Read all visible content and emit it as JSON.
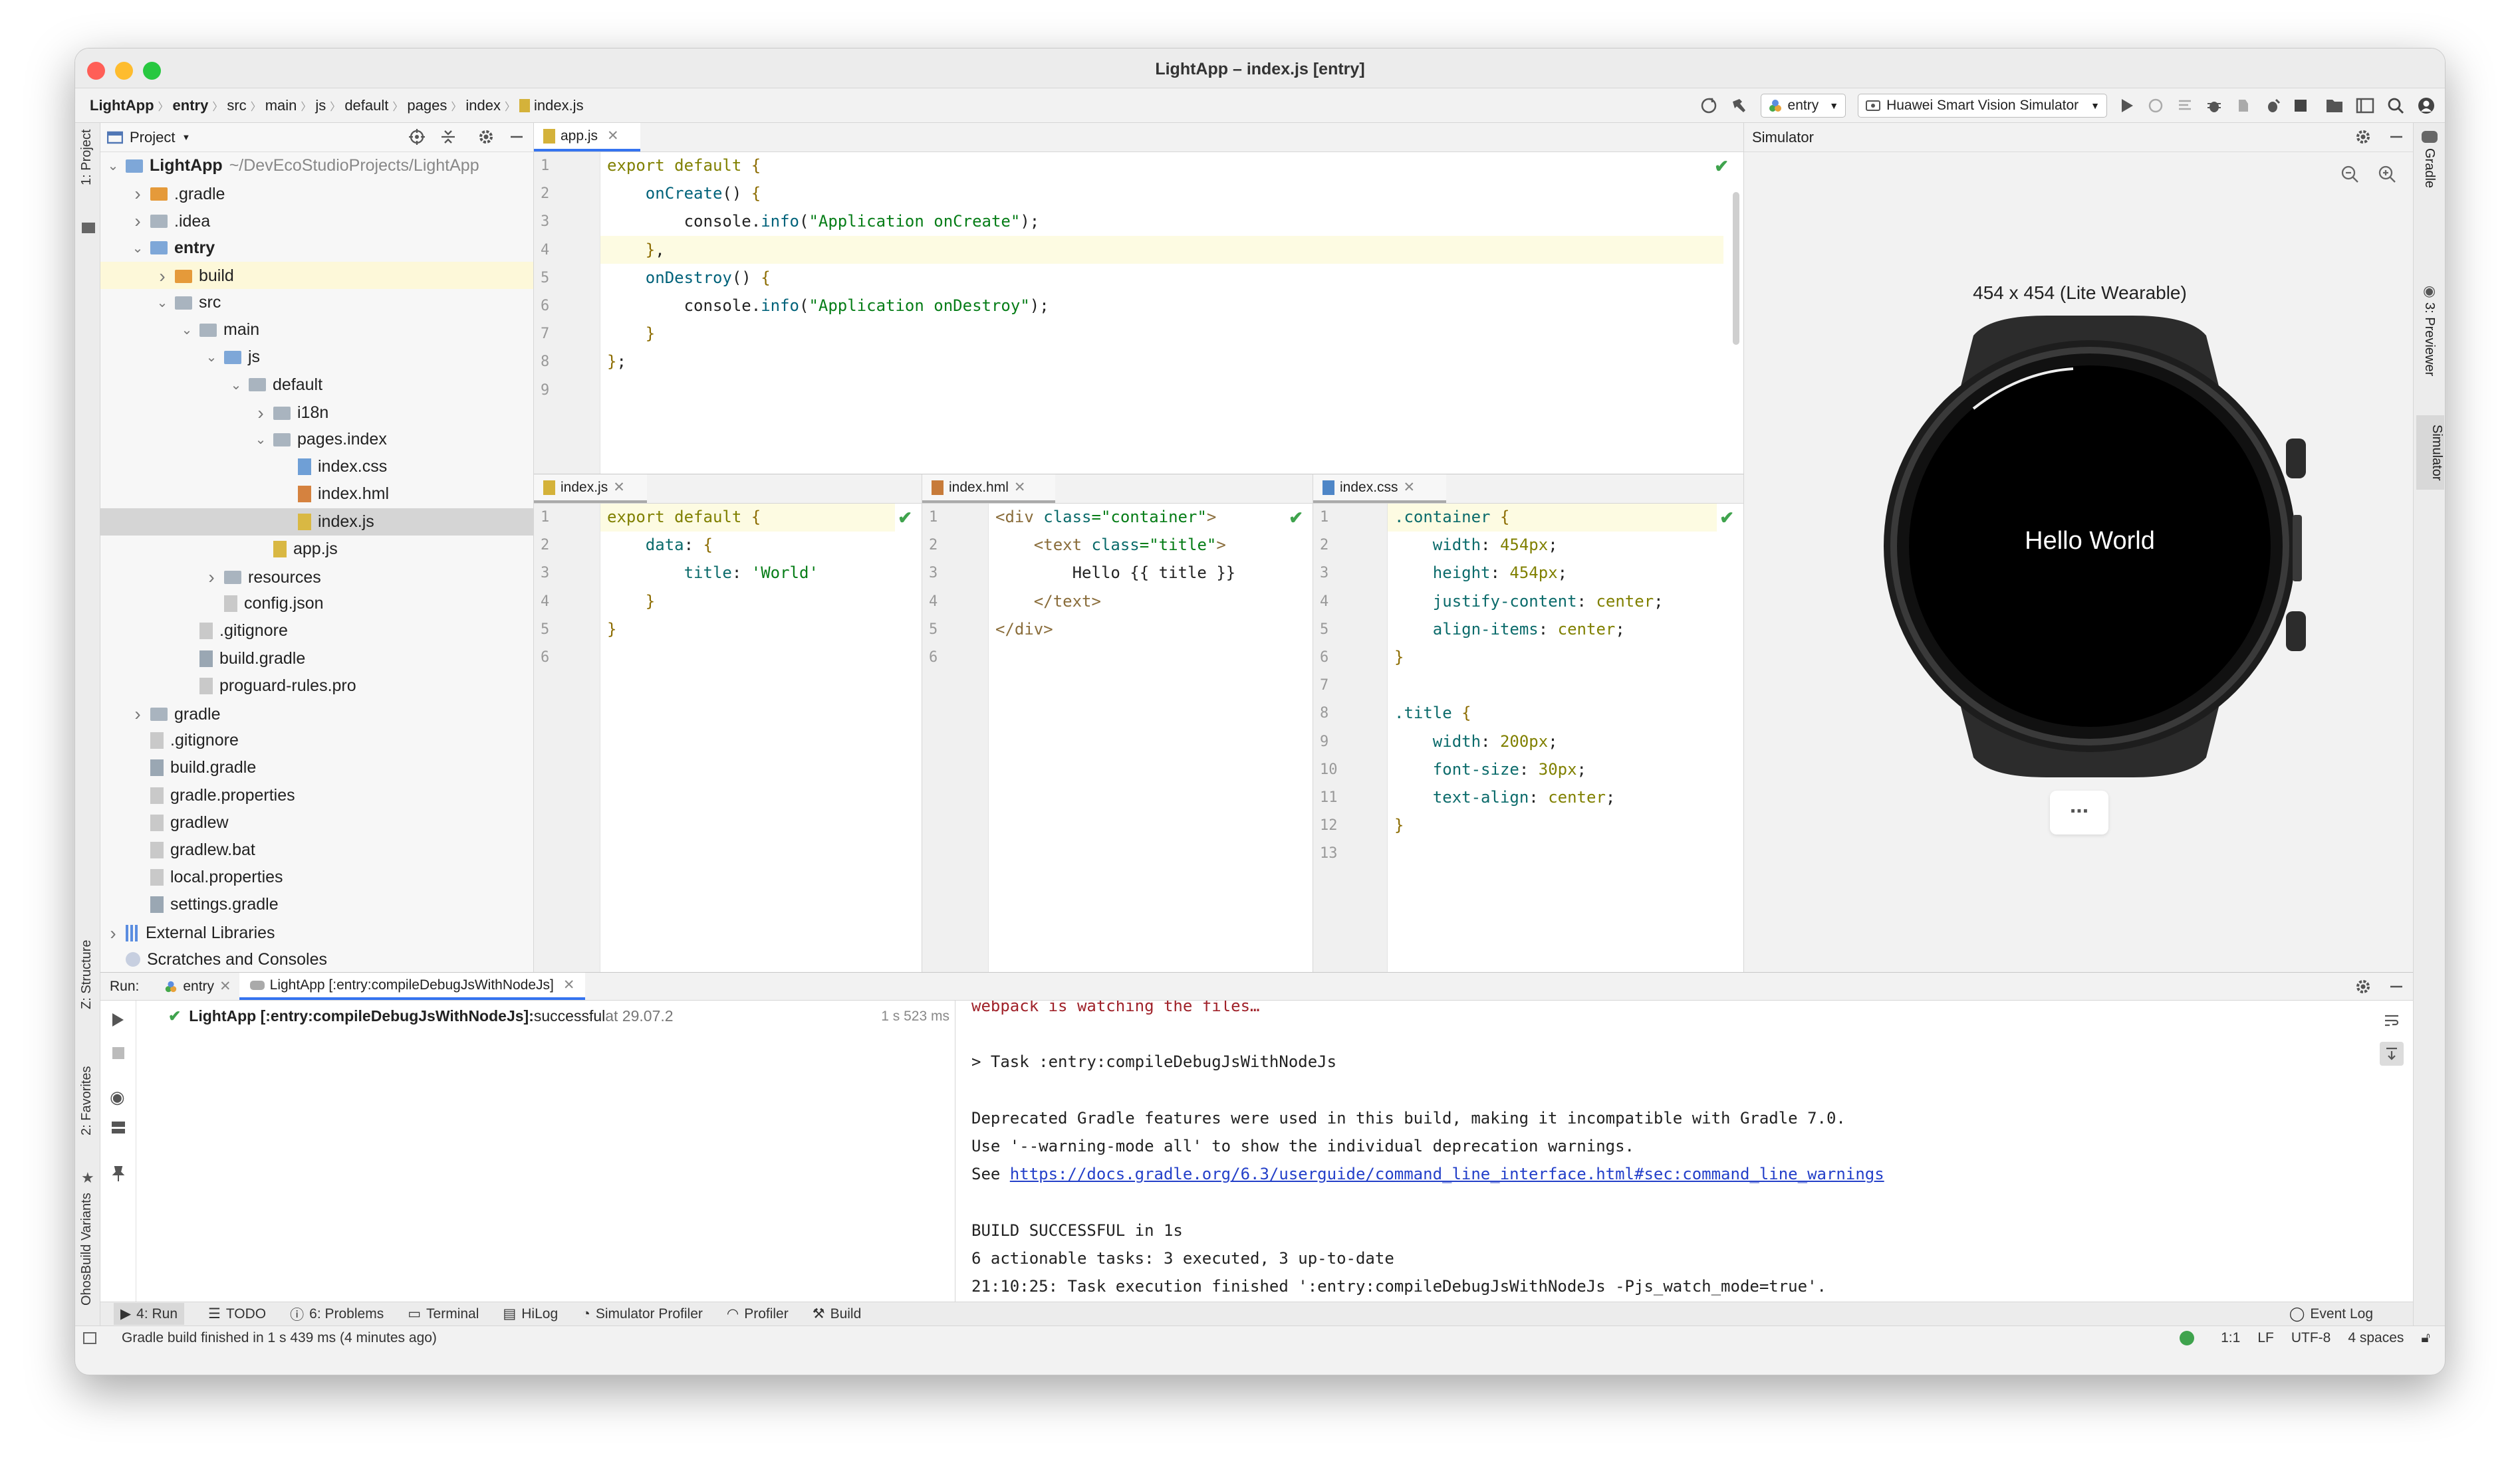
{
  "window": {
    "title": "LightApp – index.js [entry]"
  },
  "breadcrumbs": [
    "LightApp",
    "entry",
    "src",
    "main",
    "js",
    "default",
    "pages",
    "index",
    "index.js"
  ],
  "toolbar": {
    "run_config": "entry",
    "device": "Huawei Smart Vision Simulator"
  },
  "project_panel": {
    "title": "Project"
  },
  "tree": [
    {
      "label": "LightApp",
      "suffix": " ~/DevEcoStudioProjects/LightApp",
      "depth": 0,
      "arrow": "down",
      "icon": "module",
      "bold": true
    },
    {
      "label": ".gradle",
      "depth": 1,
      "arrow": "right",
      "icon": "folder-orange"
    },
    {
      "label": ".idea",
      "depth": 1,
      "arrow": "right",
      "icon": "folder"
    },
    {
      "label": "entry",
      "depth": 1,
      "arrow": "down",
      "icon": "module",
      "bold": true
    },
    {
      "label": "build",
      "depth": 2,
      "arrow": "right",
      "icon": "folder-orange",
      "hl": "yellow"
    },
    {
      "label": "src",
      "depth": 2,
      "arrow": "down",
      "icon": "folder"
    },
    {
      "label": "main",
      "depth": 3,
      "arrow": "down",
      "icon": "folder"
    },
    {
      "label": "js",
      "depth": 4,
      "arrow": "down",
      "icon": "folder-blue"
    },
    {
      "label": "default",
      "depth": 5,
      "arrow": "down",
      "icon": "folder"
    },
    {
      "label": "i18n",
      "depth": 6,
      "arrow": "right",
      "icon": "folder"
    },
    {
      "label": "pages.index",
      "depth": 6,
      "arrow": "down",
      "icon": "folder"
    },
    {
      "label": "index.css",
      "depth": 7,
      "arrow": "",
      "icon": "css"
    },
    {
      "label": "index.hml",
      "depth": 7,
      "arrow": "",
      "icon": "hml"
    },
    {
      "label": "index.js",
      "depth": 7,
      "arrow": "",
      "icon": "js",
      "hl": "selected"
    },
    {
      "label": "app.js",
      "depth": 6,
      "arrow": "",
      "icon": "js"
    },
    {
      "label": "resources",
      "depth": 4,
      "arrow": "right",
      "icon": "folder"
    },
    {
      "label": "config.json",
      "depth": 4,
      "arrow": "",
      "icon": "json"
    },
    {
      "label": ".gitignore",
      "depth": 3,
      "arrow": "",
      "icon": "file"
    },
    {
      "label": "build.gradle",
      "depth": 3,
      "arrow": "",
      "icon": "gradle"
    },
    {
      "label": "proguard-rules.pro",
      "depth": 3,
      "arrow": "",
      "icon": "file"
    },
    {
      "label": "gradle",
      "depth": 1,
      "arrow": "right",
      "icon": "folder"
    },
    {
      "label": ".gitignore",
      "depth": 1,
      "arrow": "",
      "icon": "file"
    },
    {
      "label": "build.gradle",
      "depth": 1,
      "arrow": "",
      "icon": "gradle"
    },
    {
      "label": "gradle.properties",
      "depth": 1,
      "arrow": "",
      "icon": "file"
    },
    {
      "label": "gradlew",
      "depth": 1,
      "arrow": "",
      "icon": "file"
    },
    {
      "label": "gradlew.bat",
      "depth": 1,
      "arrow": "",
      "icon": "file"
    },
    {
      "label": "local.properties",
      "depth": 1,
      "arrow": "",
      "icon": "file"
    },
    {
      "label": "settings.gradle",
      "depth": 1,
      "arrow": "",
      "icon": "gradle"
    },
    {
      "label": "External Libraries",
      "depth": 0,
      "arrow": "right",
      "icon": "lib"
    },
    {
      "label": "Scratches and Consoles",
      "depth": 0,
      "arrow": "",
      "icon": "scratch"
    }
  ],
  "left_strip": {
    "project": "1: Project",
    "structure": "Z: Structure",
    "favorites": "2: Favorites",
    "build_variants": "OhosBuild Variants"
  },
  "right_strip": {
    "gradle": "Gradle",
    "previewer": "3: Previewer",
    "simulator": "Simulator"
  },
  "editors": {
    "top": {
      "tab": "app.js",
      "lines": [
        [
          [
            "kwo",
            "export default "
          ],
          [
            "k1",
            "{"
          ]
        ],
        [
          [
            "fn",
            "    onCreate"
          ],
          [
            "",
            "() "
          ],
          [
            "k1",
            "{"
          ]
        ],
        [
          [
            "",
            "        console."
          ],
          [
            "fn",
            "info"
          ],
          [
            "",
            "("
          ],
          [
            "st",
            "\"Application onCreate\""
          ],
          [
            "",
            ");"
          ]
        ],
        [
          [
            "k1",
            "    }"
          ],
          [
            "",
            ","
          ]
        ],
        [
          [
            "fn",
            "    onDestroy"
          ],
          [
            "",
            "() "
          ],
          [
            "k1",
            "{"
          ]
        ],
        [
          [
            "",
            "        console."
          ],
          [
            "fn",
            "info"
          ],
          [
            "",
            "("
          ],
          [
            "st",
            "\"Application onDestroy\""
          ],
          [
            "",
            ");"
          ]
        ],
        [
          [
            "k1",
            "    }"
          ]
        ],
        [
          [
            "k1",
            "}"
          ],
          [
            "",
            ";"
          ]
        ],
        []
      ]
    },
    "js": {
      "tab": "index.js",
      "lines": [
        [
          [
            "kwo",
            "export default "
          ],
          [
            "k1",
            "{"
          ]
        ],
        [
          [
            "prop",
            "    data"
          ],
          [
            "",
            ": "
          ],
          [
            "k1",
            "{"
          ]
        ],
        [
          [
            "prop",
            "        title"
          ],
          [
            "",
            ": "
          ],
          [
            "st",
            "'World'"
          ]
        ],
        [
          [
            "k1",
            "    }"
          ]
        ],
        [
          [
            "k1",
            "}"
          ]
        ],
        []
      ]
    },
    "hml": {
      "tab": "index.hml",
      "lines": [
        [
          [
            "tag",
            "<div "
          ],
          [
            "prop",
            "class"
          ],
          [
            "",
            ""
          ],
          [
            "st",
            "=\"container\""
          ],
          [
            "tag",
            ">"
          ]
        ],
        [
          [
            "tag",
            "    <text "
          ],
          [
            "prop",
            "class"
          ],
          [
            "st",
            "=\"title\""
          ],
          [
            "tag",
            ">"
          ]
        ],
        [
          [
            "",
            "        Hello {{ title }}"
          ]
        ],
        [
          [
            "tag",
            "    </text>"
          ]
        ],
        [
          [
            "tag",
            "</div>"
          ]
        ],
        []
      ]
    },
    "css": {
      "tab": "index.css",
      "lines": [
        [
          [
            "prop",
            ".container "
          ],
          [
            "k1",
            "{"
          ]
        ],
        [
          [
            "prop",
            "    width"
          ],
          [
            "",
            ": "
          ],
          [
            "kwo",
            "454px"
          ],
          [
            "",
            ";"
          ]
        ],
        [
          [
            "prop",
            "    height"
          ],
          [
            "",
            ": "
          ],
          [
            "kwo",
            "454px"
          ],
          [
            "",
            ";"
          ]
        ],
        [
          [
            "prop",
            "    justify-content"
          ],
          [
            "",
            ": "
          ],
          [
            "kwo",
            "center"
          ],
          [
            "",
            ";"
          ]
        ],
        [
          [
            "prop",
            "    align-items"
          ],
          [
            "",
            ": "
          ],
          [
            "kwo",
            "center"
          ],
          [
            "",
            ";"
          ]
        ],
        [
          [
            "k1",
            "}"
          ]
        ],
        [],
        [
          [
            "prop",
            ".title "
          ],
          [
            "k1",
            "{"
          ]
        ],
        [
          [
            "prop",
            "    width"
          ],
          [
            "",
            ": "
          ],
          [
            "kwo",
            "200px"
          ],
          [
            "",
            ";"
          ]
        ],
        [
          [
            "prop",
            "    font-size"
          ],
          [
            "",
            ": "
          ],
          [
            "kwo",
            "30px"
          ],
          [
            "",
            ";"
          ]
        ],
        [
          [
            "prop",
            "    text-align"
          ],
          [
            "",
            ": "
          ],
          [
            "kwo",
            "center"
          ],
          [
            "",
            ";"
          ]
        ],
        [
          [
            "k1",
            "}"
          ]
        ],
        []
      ]
    }
  },
  "simulator": {
    "title": "Simulator",
    "device_label": "454 x 454 (Lite Wearable)",
    "screen_text": "Hello World",
    "more": "..."
  },
  "run": {
    "label": "Run:",
    "tab1": "entry",
    "tab2": "LightApp [:entry:compileDebugJsWithNodeJs]",
    "tree_bold": "LightApp [:entry:compileDebugJsWithNodeJs]:",
    "tree_status": " successful",
    "tree_time": " at 29.07.2",
    "tree_duration": "1 s 523 ms",
    "console": [
      {
        "t": "webpack is watching the files…",
        "c": "red"
      },
      {
        "t": ""
      },
      {
        "t": "> Task :entry:compileDebugJsWithNodeJs"
      },
      {
        "t": ""
      },
      {
        "t": "Deprecated Gradle features were used in this build, making it incompatible with Gradle 7.0."
      },
      {
        "t": "Use '--warning-mode all' to show the individual deprecation warnings."
      },
      {
        "t": "See ",
        "link": "https://docs.gradle.org/6.3/userguide/command_line_interface.html#sec:command_line_warnings"
      },
      {
        "t": ""
      },
      {
        "t": "BUILD SUCCESSFUL in 1s"
      },
      {
        "t": "6 actionable tasks: 3 executed, 3 up-to-date"
      },
      {
        "t": "21:10:25: Task execution finished ':entry:compileDebugJsWithNodeJs -Pjs_watch_mode=true'."
      }
    ]
  },
  "bottom_tabs": [
    "4: Run",
    "TODO",
    "6: Problems",
    "Terminal",
    "HiLog",
    "Simulator Profiler",
    "Profiler",
    "Build"
  ],
  "event_log": "Event Log",
  "status": {
    "message": "Gradle build finished in 1 s 439 ms (4 minutes ago)",
    "pos": "1:1",
    "line_sep": "LF",
    "encoding": "UTF-8",
    "indent": "4 spaces"
  },
  "colors": {
    "accent": "#3574f0",
    "selection": "#d5d5d5",
    "highlight": "#fdfbe2",
    "ok": "#3fa34d"
  }
}
